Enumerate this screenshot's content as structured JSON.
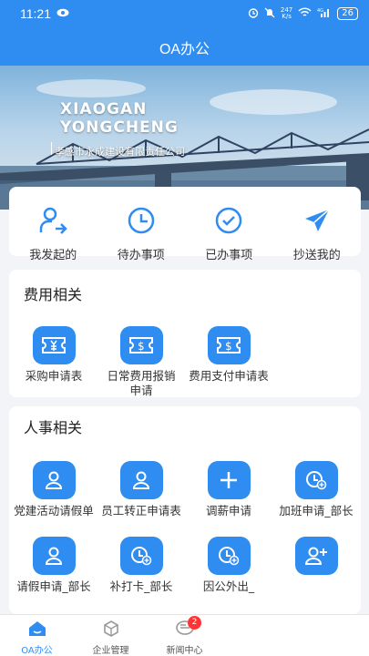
{
  "status_bar": {
    "time": "11:21",
    "speed": "247\nK/s",
    "battery": "26"
  },
  "app": {
    "title": "OA办公"
  },
  "banner": {
    "line1": "XIAOGAN",
    "line2": "YONGCHENG",
    "company": "孝感市永成建设有限责任公司"
  },
  "quick_actions": [
    {
      "label": "我发起的",
      "icon": "user-send-icon"
    },
    {
      "label": "待办事项",
      "icon": "clock-icon"
    },
    {
      "label": "已办事项",
      "icon": "check-circle-icon"
    },
    {
      "label": "抄送我的",
      "icon": "paper-plane-icon"
    }
  ],
  "expense": {
    "title": "费用相关",
    "items": [
      {
        "label": "采购申请表",
        "icon": "yuan-ticket-icon"
      },
      {
        "label": "日常费用报销申请",
        "icon": "dollar-ticket-icon"
      },
      {
        "label": "费用支付申请表",
        "icon": "dollar-ticket-icon"
      }
    ]
  },
  "hr": {
    "title": "人事相关",
    "items": [
      {
        "label": "党建活动请假单",
        "icon": "user-icon"
      },
      {
        "label": "员工转正申请表",
        "icon": "user-icon"
      },
      {
        "label": "调薪申请",
        "icon": "plus-icon"
      },
      {
        "label": "加班申请_部长",
        "icon": "clock-plus-icon"
      },
      {
        "label": "请假申请_部长",
        "icon": "user-icon"
      },
      {
        "label": "补打卡_部长",
        "icon": "clock-plus-icon"
      },
      {
        "label": "因公外出_",
        "icon": "clock-plus-icon"
      },
      {
        "label": "",
        "icon": "user-add-icon"
      }
    ]
  },
  "tabbar": [
    {
      "label": "OA办公",
      "icon": "home-icon",
      "active": true
    },
    {
      "label": "企业管理",
      "icon": "cube-icon",
      "active": false
    },
    {
      "label": "新闻中心",
      "icon": "message-icon",
      "active": false,
      "badge": "2"
    }
  ],
  "colors": {
    "primary": "#2f8cf0",
    "background": "#f2f4f7",
    "badge": "#ff3333"
  }
}
